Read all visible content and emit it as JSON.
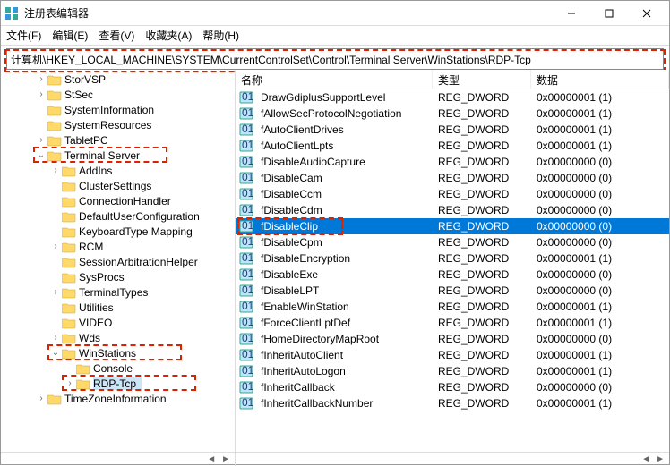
{
  "window": {
    "title": "注册表编辑器"
  },
  "menu": {
    "file": "文件(F)",
    "edit": "编辑(E)",
    "view": "查看(V)",
    "fav": "收藏夹(A)",
    "help": "帮助(H)"
  },
  "address": "计算机\\HKEY_LOCAL_MACHINE\\SYSTEM\\CurrentControlSet\\Control\\Terminal Server\\WinStations\\RDP-Tcp",
  "columns": {
    "name": "名称",
    "type": "类型",
    "data": "数据"
  },
  "tree": [
    {
      "d": 2,
      "e": "closed",
      "l": "StorVSP"
    },
    {
      "d": 2,
      "e": "closed",
      "l": "StSec"
    },
    {
      "d": 2,
      "e": "none",
      "l": "SystemInformation"
    },
    {
      "d": 2,
      "e": "none",
      "l": "SystemResources"
    },
    {
      "d": 2,
      "e": "closed",
      "l": "TabletPC"
    },
    {
      "d": 2,
      "e": "open",
      "l": "Terminal Server",
      "hl": true
    },
    {
      "d": 3,
      "e": "closed",
      "l": "AddIns"
    },
    {
      "d": 3,
      "e": "none",
      "l": "ClusterSettings"
    },
    {
      "d": 3,
      "e": "none",
      "l": "ConnectionHandler"
    },
    {
      "d": 3,
      "e": "none",
      "l": "DefaultUserConfiguration"
    },
    {
      "d": 3,
      "e": "none",
      "l": "KeyboardType Mapping"
    },
    {
      "d": 3,
      "e": "closed",
      "l": "RCM"
    },
    {
      "d": 3,
      "e": "none",
      "l": "SessionArbitrationHelper"
    },
    {
      "d": 3,
      "e": "none",
      "l": "SysProcs"
    },
    {
      "d": 3,
      "e": "closed",
      "l": "TerminalTypes"
    },
    {
      "d": 3,
      "e": "none",
      "l": "Utilities"
    },
    {
      "d": 3,
      "e": "none",
      "l": "VIDEO"
    },
    {
      "d": 3,
      "e": "closed",
      "l": "Wds"
    },
    {
      "d": 3,
      "e": "open",
      "l": "WinStations",
      "hl": true
    },
    {
      "d": 4,
      "e": "none",
      "l": "Console"
    },
    {
      "d": 4,
      "e": "closed",
      "l": "RDP-Tcp",
      "sel": true,
      "hl": true
    },
    {
      "d": 2,
      "e": "closed",
      "l": "TimeZoneInformation"
    }
  ],
  "values": [
    {
      "n": "DrawGdiplusSupportLevel",
      "t": "REG_DWORD",
      "d": "0x00000001 (1)"
    },
    {
      "n": "fAllowSecProtocolNegotiation",
      "t": "REG_DWORD",
      "d": "0x00000001 (1)"
    },
    {
      "n": "fAutoClientDrives",
      "t": "REG_DWORD",
      "d": "0x00000001 (1)"
    },
    {
      "n": "fAutoClientLpts",
      "t": "REG_DWORD",
      "d": "0x00000001 (1)"
    },
    {
      "n": "fDisableAudioCapture",
      "t": "REG_DWORD",
      "d": "0x00000000 (0)"
    },
    {
      "n": "fDisableCam",
      "t": "REG_DWORD",
      "d": "0x00000000 (0)"
    },
    {
      "n": "fDisableCcm",
      "t": "REG_DWORD",
      "d": "0x00000000 (0)"
    },
    {
      "n": "fDisableCdm",
      "t": "REG_DWORD",
      "d": "0x00000000 (0)"
    },
    {
      "n": "fDisableClip",
      "t": "REG_DWORD",
      "d": "0x00000000 (0)",
      "sel": true,
      "hl": true
    },
    {
      "n": "fDisableCpm",
      "t": "REG_DWORD",
      "d": "0x00000000 (0)"
    },
    {
      "n": "fDisableEncryption",
      "t": "REG_DWORD",
      "d": "0x00000001 (1)"
    },
    {
      "n": "fDisableExe",
      "t": "REG_DWORD",
      "d": "0x00000000 (0)"
    },
    {
      "n": "fDisableLPT",
      "t": "REG_DWORD",
      "d": "0x00000000 (0)"
    },
    {
      "n": "fEnableWinStation",
      "t": "REG_DWORD",
      "d": "0x00000001 (1)"
    },
    {
      "n": "fForceClientLptDef",
      "t": "REG_DWORD",
      "d": "0x00000001 (1)"
    },
    {
      "n": "fHomeDirectoryMapRoot",
      "t": "REG_DWORD",
      "d": "0x00000000 (0)"
    },
    {
      "n": "fInheritAutoClient",
      "t": "REG_DWORD",
      "d": "0x00000001 (1)"
    },
    {
      "n": "fInheritAutoLogon",
      "t": "REG_DWORD",
      "d": "0x00000001 (1)"
    },
    {
      "n": "fInheritCallback",
      "t": "REG_DWORD",
      "d": "0x00000000 (0)"
    },
    {
      "n": "fInheritCallbackNumber",
      "t": "REG_DWORD",
      "d": "0x00000001 (1)"
    }
  ]
}
